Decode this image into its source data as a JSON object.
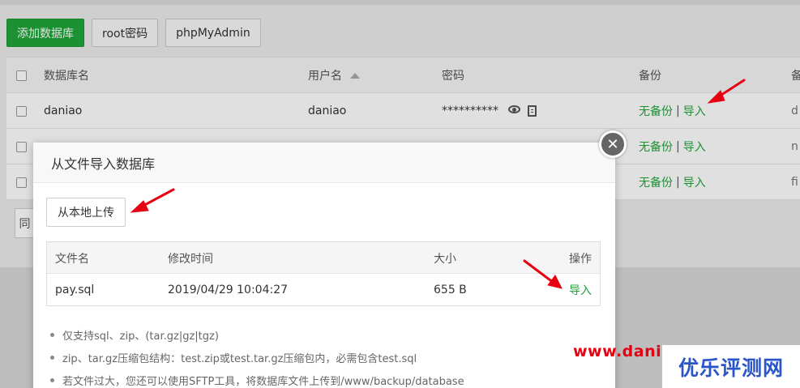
{
  "toolbar": {
    "add_db_label": "添加数据库",
    "root_pw_label": "root密码",
    "phpmyadmin_label": "phpMyAdmin"
  },
  "db_table": {
    "headers": {
      "name": "数据库名",
      "user": "用户名",
      "password": "密码",
      "backup": "备份",
      "extra": "备"
    },
    "rows": [
      {
        "name": "daniao",
        "user": "daniao",
        "password": "**********",
        "backup_status": "无备份",
        "backup_sep": "|",
        "import": "导入",
        "extra": "d"
      },
      {
        "name": "",
        "user": "",
        "password": "",
        "backup_status": "无备份",
        "backup_sep": "|",
        "import": "导入",
        "extra": "n"
      },
      {
        "name": "",
        "user": "",
        "password": "",
        "backup_status": "无备份",
        "backup_sep": "|",
        "import": "导入",
        "extra": "fi"
      }
    ]
  },
  "pager_partial": "同",
  "modal": {
    "title": "从文件导入数据库",
    "close_glyph": "✕",
    "upload_label": "从本地上传",
    "file_table": {
      "headers": {
        "name": "文件名",
        "time": "修改时间",
        "size": "大小",
        "op": "操作"
      },
      "rows": [
        {
          "name": "pay.sql",
          "time": "2019/04/29 10:04:27",
          "size": "655 B",
          "op": "导入"
        }
      ]
    },
    "notes": [
      "仅支持sql、zip、(tar.gz|gz|tgz)",
      "zip、tar.gz压缩包结构：test.zip或test.tar.gz压缩包内，必需包含test.sql",
      "若文件过大，您还可以使用SFTP工具，将数据库文件上传到/www/backup/database"
    ]
  },
  "watermark": {
    "url": "www.dani",
    "logo": "优乐评测网"
  },
  "colors": {
    "green": "#20a53a",
    "arrow_red": "#e60012",
    "logo_blue": "#2a55c8"
  }
}
